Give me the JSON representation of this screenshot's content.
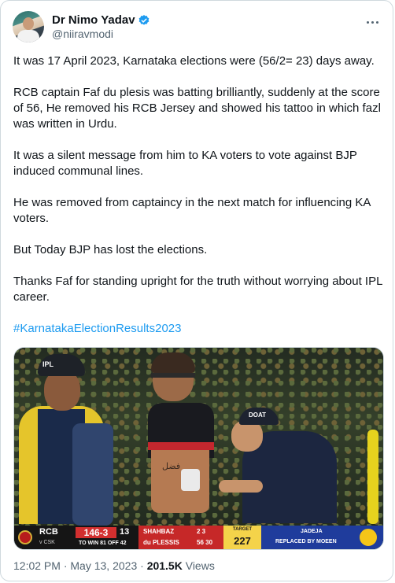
{
  "author": {
    "name": "Dr Nimo Yadav",
    "handle": "@niiravmodi",
    "verified_icon": "verified-badge-icon",
    "verified_color": "#1d9bf0"
  },
  "tweet": {
    "paragraphs": [
      "It was 17 April 2023, Karnataka elections were (56/2= 23) days away.",
      "RCB captain Faf du plesis was batting brilliantly, suddenly at the score of 56, He removed his RCB Jersey and showed his tattoo in which fazl was written in Urdu.",
      "It was a silent message from him to KA voters to vote against BJP induced communal lines.",
      "He was removed from captaincy in the next match for influencing KA voters.",
      "But Today BJP has lost the elections.",
      "Thanks Faf for standing upright for the truth without worrying about IPL career."
    ],
    "hashtag": "#KarnatakaElectionResults2023",
    "hashtag_color": "#1d9bf0"
  },
  "scoreboard": {
    "team": "RCB",
    "opponent": "v CSK",
    "score": "146-3",
    "overs": "13",
    "need": "TO WIN 81 OFF 42",
    "batter1": "SHAHBAZ",
    "batter1_runs": "2 3",
    "batter2": "du PLESSIS",
    "batter2_runs": "56 30",
    "target_label": "TARGET",
    "target": "227",
    "bowler": "JADEJA",
    "note": "REPLACED BY MOEEN"
  },
  "image_text": {
    "cap_logo": "IPL",
    "tattoo": "فضل",
    "cap_right_logo": "DOAT"
  },
  "meta": {
    "time": "12:02 PM",
    "date": "May 13, 2023",
    "views_count": "201.5K",
    "views_label": "Views",
    "sep": "·"
  }
}
